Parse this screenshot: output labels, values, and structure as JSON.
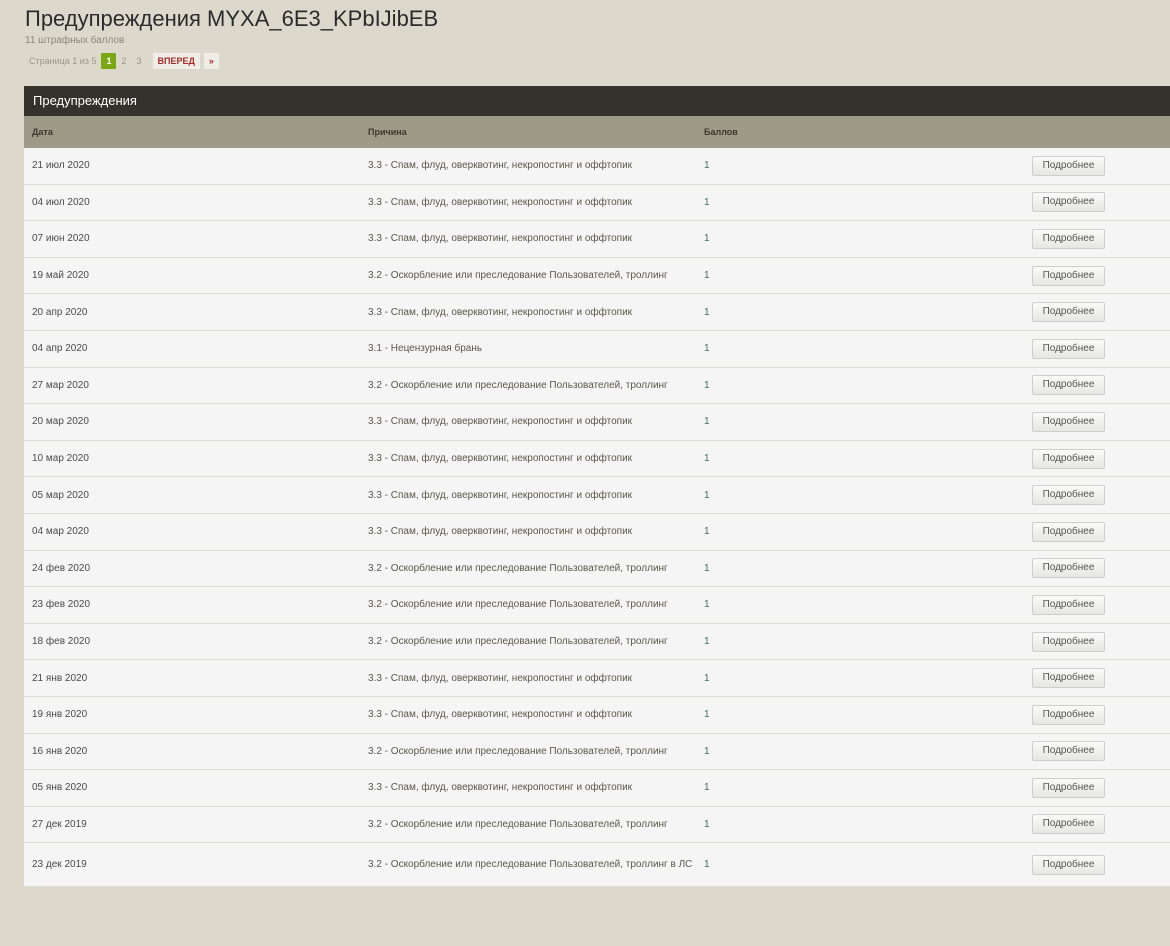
{
  "page": {
    "title": "Предупреждения MYXA_6E3_KPbIJibEB",
    "subtitle": "11 штрафных баллов"
  },
  "pager": {
    "label": "Страница 1 из 5",
    "pages": [
      "1",
      "2",
      "3"
    ],
    "current": "1",
    "next_label": "ВПЕРЕД",
    "last_label": "»"
  },
  "panel": {
    "title": "Предупреждения",
    "columns": {
      "date": "Дата",
      "reason": "Причина",
      "points": "Баллов"
    },
    "button_label": "Подробнее",
    "rows": [
      {
        "date": "21 июл 2020",
        "reason": "3.3 - Спам, флуд, оверквотинг, некропостинг и оффтопик",
        "points": "1"
      },
      {
        "date": "04 июл 2020",
        "reason": "3.3 - Спам, флуд, оверквотинг, некропостинг и оффтопик",
        "points": "1"
      },
      {
        "date": "07 июн 2020",
        "reason": "3.3 - Спам, флуд, оверквотинг, некропостинг и оффтопик",
        "points": "1"
      },
      {
        "date": "19 май 2020",
        "reason": "3.2 - Оскорбление или преследование Пользователей, троллинг",
        "points": "1"
      },
      {
        "date": "20 апр 2020",
        "reason": "3.3 - Спам, флуд, оверквотинг, некропостинг и оффтопик",
        "points": "1"
      },
      {
        "date": "04 апр 2020",
        "reason": "3.1 - Нецензурная брань",
        "points": "1"
      },
      {
        "date": "27 мар 2020",
        "reason": "3.2 - Оскорбление или преследование Пользователей, троллинг",
        "points": "1"
      },
      {
        "date": "20 мар 2020",
        "reason": "3.3 - Спам, флуд, оверквотинг, некропостинг и оффтопик",
        "points": "1"
      },
      {
        "date": "10 мар 2020",
        "reason": "3.3 - Спам, флуд, оверквотинг, некропостинг и оффтопик",
        "points": "1"
      },
      {
        "date": "05 мар 2020",
        "reason": "3.3 - Спам, флуд, оверквотинг, некропостинг и оффтопик",
        "points": "1"
      },
      {
        "date": "04 мар 2020",
        "reason": "3.3 - Спам, флуд, оверквотинг, некропостинг и оффтопик",
        "points": "1"
      },
      {
        "date": "24 фев 2020",
        "reason": "3.2 - Оскорбление или преследование Пользователей, троллинг",
        "points": "1"
      },
      {
        "date": "23 фев 2020",
        "reason": "3.2 - Оскорбление или преследование Пользователей, троллинг",
        "points": "1"
      },
      {
        "date": "18 фев 2020",
        "reason": "3.2 - Оскорбление или преследование Пользователей, троллинг",
        "points": "1"
      },
      {
        "date": "21 янв 2020",
        "reason": "3.3 - Спам, флуд, оверквотинг, некропостинг и оффтопик",
        "points": "1"
      },
      {
        "date": "19 янв 2020",
        "reason": "3.3 - Спам, флуд, оверквотинг, некропостинг и оффтопик",
        "points": "1"
      },
      {
        "date": "16 янв 2020",
        "reason": "3.2 - Оскорбление или преследование Пользователей, троллинг",
        "points": "1"
      },
      {
        "date": "05 янв 2020",
        "reason": "3.3 - Спам, флуд, оверквотинг, некропостинг и оффтопик",
        "points": "1"
      },
      {
        "date": "27 дек 2019",
        "reason": "3.2 - Оскорбление или преследование Пользователей, троллинг",
        "points": "1"
      },
      {
        "date": "23 дек 2019",
        "reason": "3.2 - Оскорбление или преследование Пользователей, троллинг в ЛС",
        "points": "1"
      }
    ]
  }
}
